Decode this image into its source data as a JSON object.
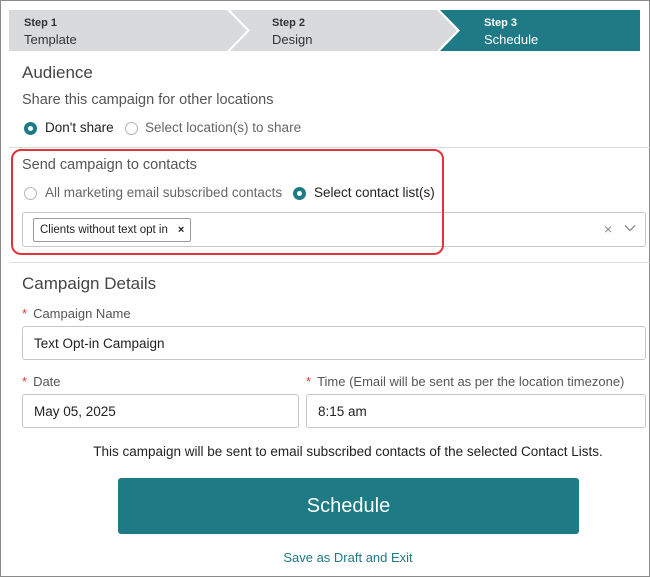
{
  "stepper": {
    "steps": [
      {
        "num": "Step 1",
        "name": "Template",
        "active": false
      },
      {
        "num": "Step 2",
        "name": "Design",
        "active": false
      },
      {
        "num": "Step 3",
        "name": "Schedule",
        "active": true
      }
    ]
  },
  "audience": {
    "title": "Audience",
    "share_question": "Share this campaign for other locations",
    "share_options": [
      "Don't share",
      "Select location(s) to share"
    ],
    "share_selected": "Don't share"
  },
  "send_to": {
    "title": "Send campaign to contacts",
    "options": [
      "All marketing email subscribed contacts",
      "Select contact list(s)"
    ],
    "selected": "Select contact list(s)",
    "selected_lists": [
      "Clients without text opt in"
    ],
    "tag_remove": "×",
    "clear": "×"
  },
  "details": {
    "title": "Campaign Details",
    "required_mark": "*",
    "campaign_name_label": "Campaign Name",
    "campaign_name_value": "Text Opt-in Campaign",
    "date_label": "Date",
    "date_value": "May 05, 2025",
    "time_label": "Time (Email will be sent as per the location timezone)",
    "time_value": "8:15 am"
  },
  "note": "This campaign will be sent to email subscribed contacts of the selected Contact Lists.",
  "actions": {
    "schedule_label": "Schedule",
    "draft_label": "Save as Draft and Exit"
  },
  "colors": {
    "accent": "#1e7a85",
    "step_inactive": "#d8dadc",
    "highlight": "#e0343a"
  }
}
